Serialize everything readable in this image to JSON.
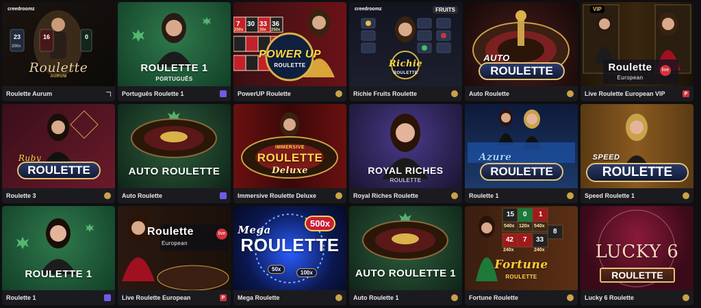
{
  "tiles": [
    {
      "caption": "Roulette Aurum",
      "provider": "line-icon",
      "art": {
        "logo": "creedroomz",
        "title": "Roulette",
        "sub": "AURUM",
        "chips": [
          "23",
          "16",
          "0"
        ],
        "chip_values": [
          "200x"
        ]
      }
    },
    {
      "caption": "Português Roulette 1",
      "provider": "pragmatic-icon",
      "art": {
        "title": "ROULETTE 1",
        "sub": "PORTUGUÊS"
      }
    },
    {
      "caption": "PowerUP Roulette",
      "provider": "evolution-icon",
      "art": {
        "title": "POWER UP",
        "sub": "ROULETTE",
        "nums": [
          "7",
          "30",
          "33",
          "36",
          "250x",
          "30x",
          "250x"
        ]
      }
    },
    {
      "caption": "Richie Fruits Roulette",
      "provider": "evolution-icon",
      "art": {
        "logo": "creedroomz",
        "badge": "FRUITS",
        "title": "Richie",
        "sub": "ROULETTE"
      }
    },
    {
      "caption": "Auto Roulette",
      "provider": "evolution-icon",
      "art": {
        "title": "AUTO",
        "title2": "ROULETTE"
      }
    },
    {
      "caption": "Live Roulette European VIP",
      "provider": "playtech-icon",
      "art": {
        "badge": "VIP",
        "title": "Roulette",
        "live": "live",
        "sub": "European"
      }
    },
    {
      "caption": "Roulette 3",
      "provider": "evolution-icon",
      "art": {
        "title": "Ruby",
        "title2": "ROULETTE"
      }
    },
    {
      "caption": "Auto Roulette",
      "provider": "pragmatic-icon",
      "art": {
        "title": "AUTO ROULETTE"
      }
    },
    {
      "caption": "Immersive Roulette Deluxe",
      "provider": "evolution-icon",
      "art": {
        "title": "IMMERSIVE",
        "title2": "ROULETTE",
        "sub": "Deluxe"
      }
    },
    {
      "caption": "Royal Riches Roulette",
      "provider": "evolution-icon",
      "art": {
        "title": "ROYAL RICHES",
        "sub": "ROULETTE"
      }
    },
    {
      "caption": "Roulette 1",
      "provider": "evolution-icon",
      "art": {
        "title": "Azure",
        "title2": "ROULETTE"
      }
    },
    {
      "caption": "Speed Roulette 1",
      "provider": "evolution-icon",
      "art": {
        "title": "SPEED",
        "title2": "ROULETTE"
      }
    },
    {
      "caption": "Roulette 1",
      "provider": "pragmatic-icon",
      "art": {
        "title": "ROULETTE 1"
      }
    },
    {
      "caption": "Live Roulette European",
      "provider": "playtech-icon",
      "art": {
        "title": "Roulette",
        "live": "live",
        "sub": "European"
      }
    },
    {
      "caption": "Mega Roulette",
      "provider": "evolution-icon",
      "art": {
        "title": "Mega",
        "title2": "ROULETTE",
        "mult": "500x",
        "m2": "50x",
        "m3": "100x"
      }
    },
    {
      "caption": "Auto Roulette 1",
      "provider": "evolution-icon",
      "art": {
        "title": "AUTO ROULETTE 1"
      }
    },
    {
      "caption": "Fortune Roulette",
      "provider": "evolution-icon",
      "art": {
        "title": "Fortune",
        "sub": "ROULETTE",
        "nums": [
          "15",
          "0",
          "1",
          "540x",
          "120x",
          "540x",
          "42",
          "7",
          "33",
          "240x",
          "240x",
          "8"
        ]
      }
    },
    {
      "caption": "Lucky 6 Roulette",
      "provider": "evolution-icon",
      "art": {
        "title": "LUCKY 6",
        "sub": "ROULETTE"
      }
    }
  ],
  "colors": {
    "bg": "#0f0f11",
    "caption_bg": "#1b1b1f",
    "gold": "#c9a24a",
    "pragmatic": "#6c5ce7",
    "playtech": "#d3323c"
  }
}
